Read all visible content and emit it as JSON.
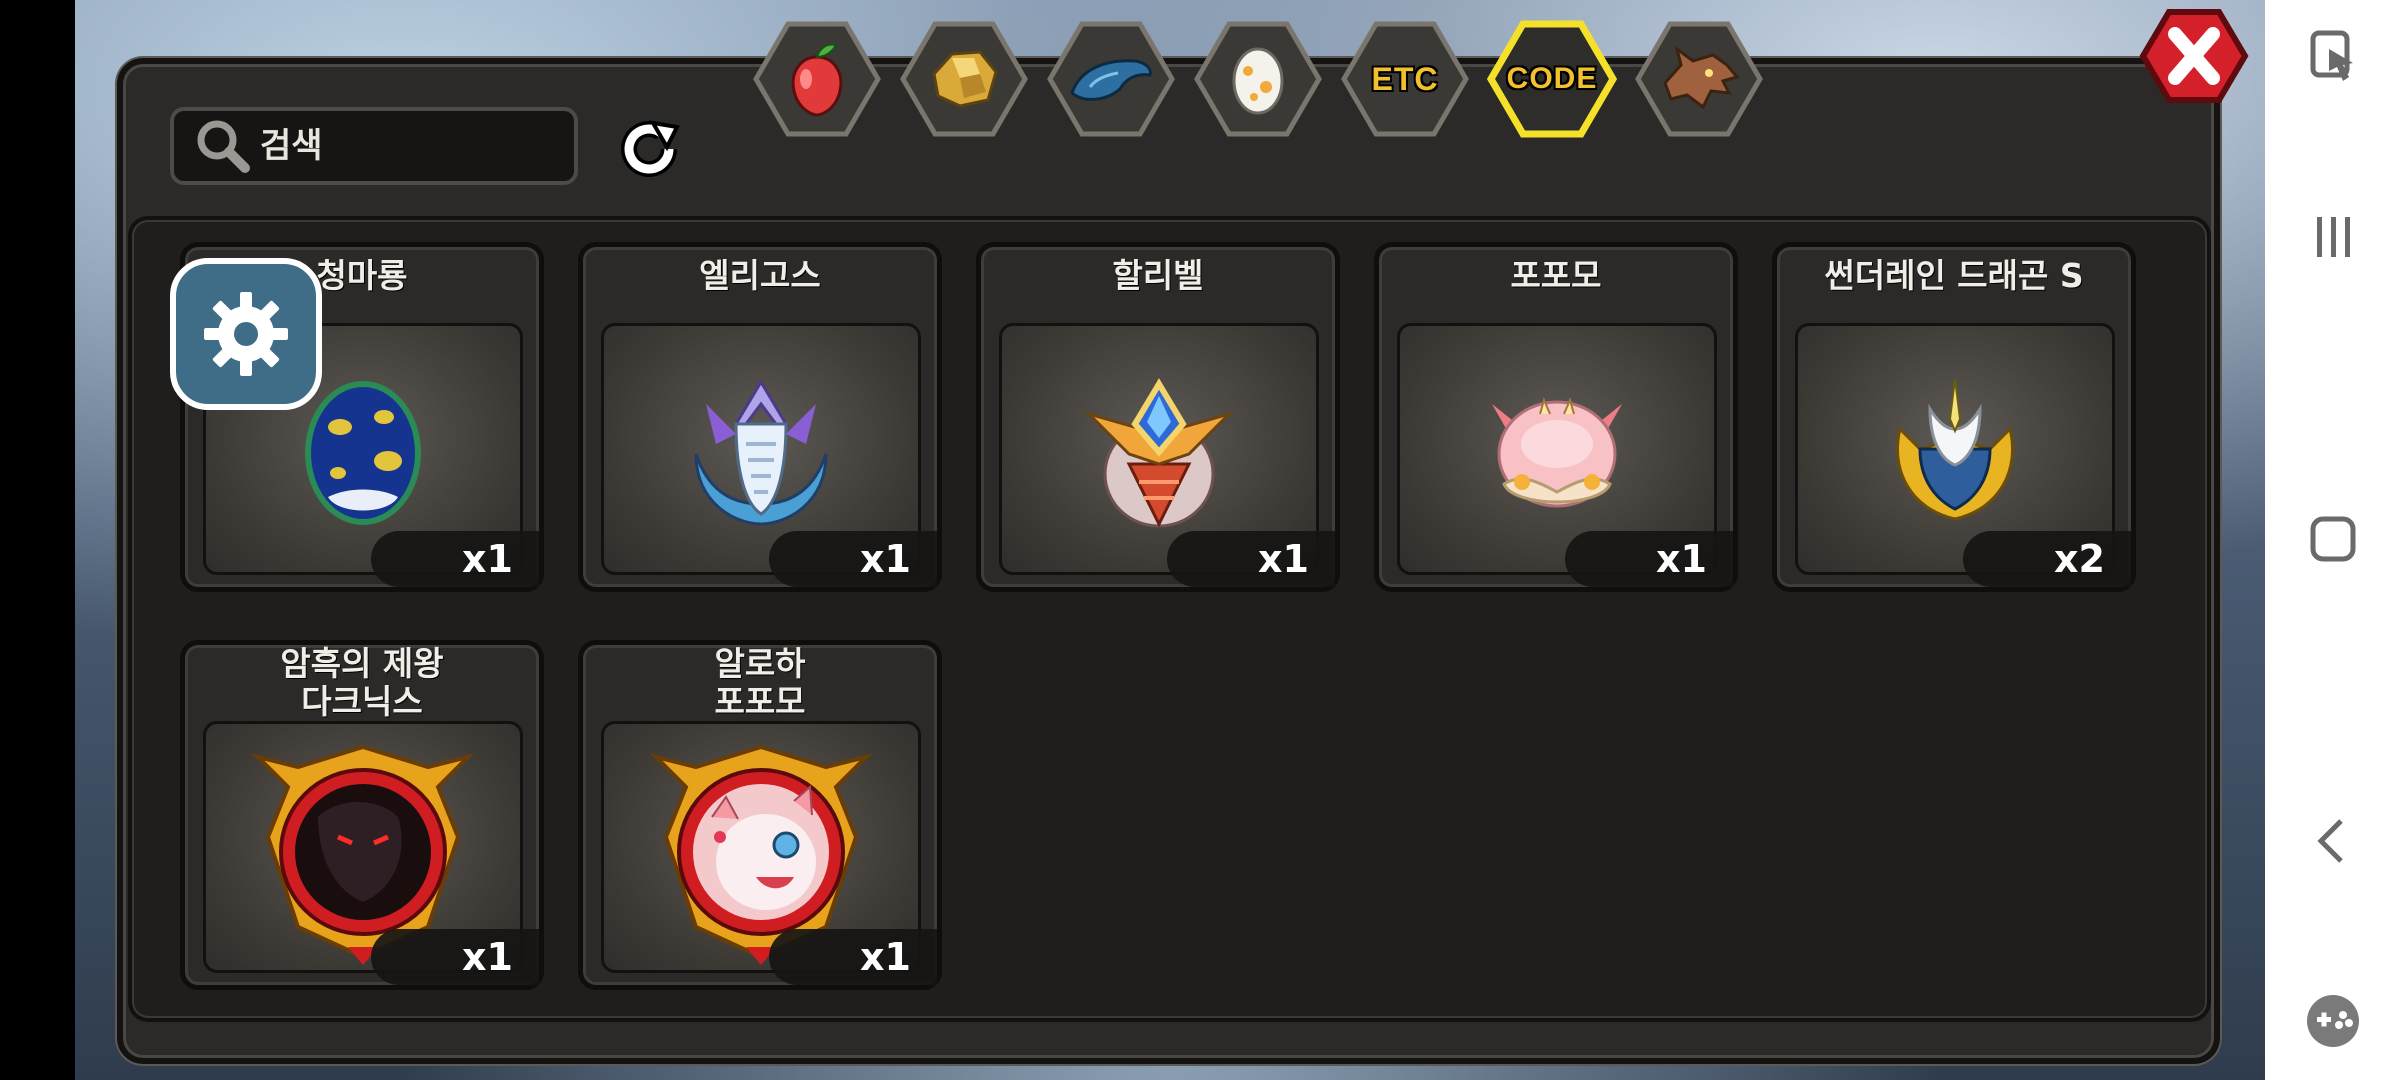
{
  "search": {
    "placeholder": "검색"
  },
  "tabs": [
    {
      "id": "fruit",
      "label": "",
      "icon": "fruit-icon"
    },
    {
      "id": "ore",
      "label": "",
      "icon": "gold-ore-icon"
    },
    {
      "id": "scale",
      "label": "",
      "icon": "dragon-scale-icon"
    },
    {
      "id": "egg",
      "label": "",
      "icon": "egg-icon"
    },
    {
      "id": "etc",
      "label": "ETC",
      "icon": ""
    },
    {
      "id": "code",
      "label": "CODE",
      "icon": "",
      "selected": true
    },
    {
      "id": "dragon",
      "label": "",
      "icon": "dragon-head-icon"
    }
  ],
  "items": [
    {
      "name": "청마룡",
      "count": "x1",
      "icon": "blue-egg-icon"
    },
    {
      "name": "엘리고스",
      "count": "x1",
      "icon": "eligos-emblem-icon"
    },
    {
      "name": "할리벨",
      "count": "x1",
      "icon": "halibel-emblem-icon"
    },
    {
      "name": "포포모",
      "count": "x1",
      "icon": "popomo-icon"
    },
    {
      "name": "썬더레인 드래곤 S",
      "count": "x2",
      "icon": "thunderrain-emblem-icon"
    },
    {
      "name_line1": "암흑의 제왕",
      "name_line2": "다크닉스",
      "count": "x1",
      "icon": "darknix-portrait-icon"
    },
    {
      "name_line1": "알로하",
      "name_line2": "포포모",
      "count": "x1",
      "icon": "aloha-popomo-portrait-icon"
    }
  ],
  "colors": {
    "panel": "#2b2a28",
    "accent_gold": "#f2c12e",
    "close_red": "#d4202a",
    "settings_blue": "#3f6d88"
  }
}
